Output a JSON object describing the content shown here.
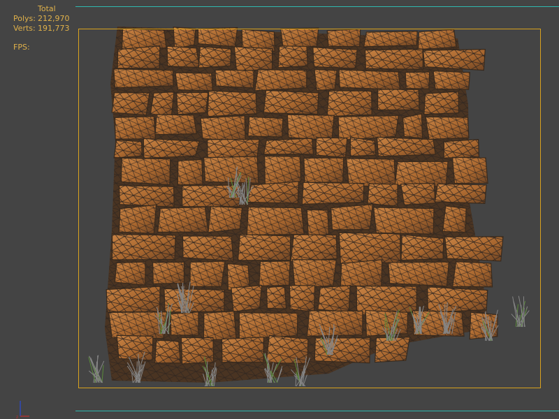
{
  "stats": {
    "header": "Total",
    "polys_label": "Polys:",
    "polys_value": "212,970",
    "verts_label": "Verts:",
    "verts_value": "191,773",
    "fps_label": "FPS:"
  },
  "scene": {
    "description_icon": "stone-wall-wireframe-mesh",
    "colors": {
      "background": "#444444",
      "safe_frame": "#d9a21e",
      "guide_line": "#2fb8b0",
      "stone_fill": "#b07035",
      "stone_dark": "#5a3a22",
      "wireframe": "#2a2a2a",
      "grass": "#7a7a7a",
      "grass_green": "#5a8a3a",
      "stats_text": "#e0b14a"
    }
  }
}
